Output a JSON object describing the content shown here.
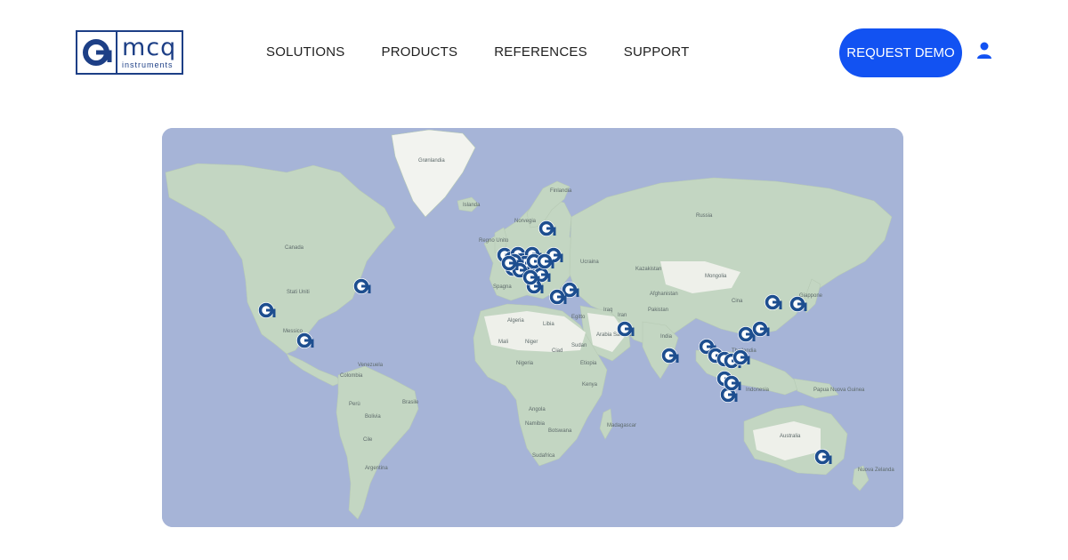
{
  "brand": {
    "logo_main": "mcq",
    "logo_sub": "instruments"
  },
  "nav": {
    "items": [
      "SOLUTIONS",
      "PRODUCTS",
      "REFERENCES",
      "SUPPORT"
    ]
  },
  "header": {
    "cta_label": "REQUEST DEMO",
    "user_icon": "user-icon"
  },
  "map": {
    "labels": [
      "Grønlandia",
      "Islanda",
      "Norvegia",
      "Finlandia",
      "Regno Unito",
      "Russia",
      "Canada",
      "Stati Uniti",
      "Messico",
      "Venezuela",
      "Colombia",
      "Perù",
      "Bolivia",
      "Brasile",
      "Cile",
      "Argentina",
      "Spagna",
      "Algeria",
      "Libia",
      "Egitto",
      "Mali",
      "Niger",
      "Ciad",
      "Sudan",
      "Nigeria",
      "Etiopia",
      "Kenya",
      "Angola",
      "Namibia",
      "Botswana",
      "Sudafrica",
      "Madagascar",
      "Iraq",
      "Iran",
      "Arabia Saudita",
      "Afghanistan",
      "Pakistan",
      "India",
      "Kazakistan",
      "Mongolia",
      "Cina",
      "Giappone",
      "Indonesia",
      "Papua Nuova Guinea",
      "Australia",
      "Nuova Zelanda",
      "Ucraina",
      "Thailandia"
    ],
    "marker_icon": "mcq-location-pin-icon",
    "marker_color": "#1d4e8f",
    "marker_count": 41
  }
}
